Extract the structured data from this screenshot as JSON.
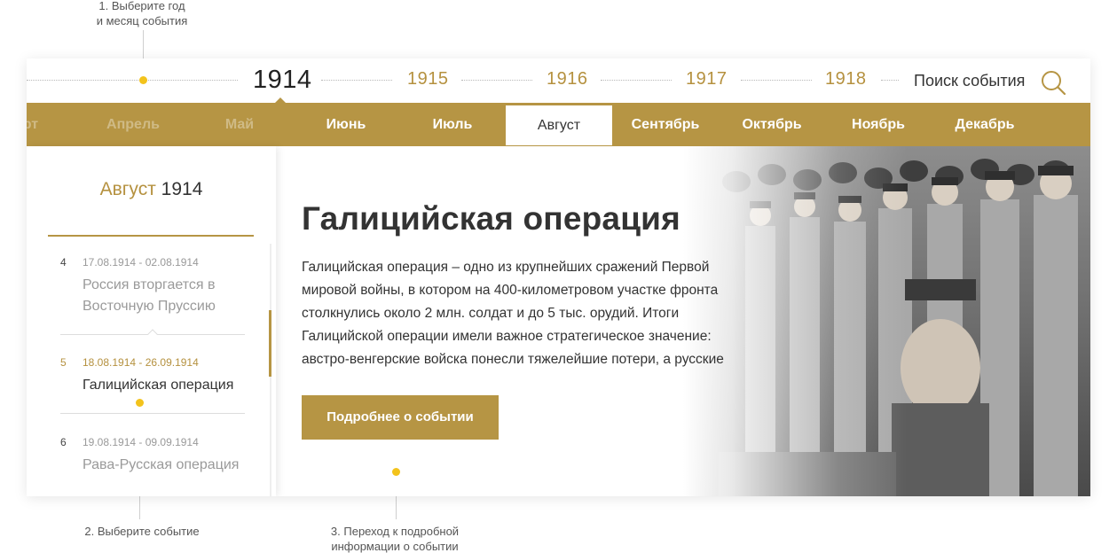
{
  "hints": {
    "step1_line1": "1. Выберите год",
    "step1_line2": "и месяц события",
    "step2": "2. Выберите событие",
    "step3_line1": "3. Переход к подробной",
    "step3_line2": "информации о событии"
  },
  "years": {
    "items": [
      "1914",
      "1915",
      "1916",
      "1917",
      "1918"
    ],
    "active": "1914"
  },
  "search": {
    "label": "Поиск события",
    "icon": "search-icon"
  },
  "months": {
    "items": [
      "арт",
      "Апрель",
      "Май",
      "Июнь",
      "Июль",
      "Август",
      "Сентябрь",
      "Октябрь",
      "Ноябрь",
      "Декабрь"
    ],
    "active": "Август"
  },
  "sidebar": {
    "title_month": "Август",
    "title_year": "1914",
    "events": [
      {
        "num": "4",
        "date": "17.08.1914 - 02.08.1914",
        "title": "Россия вторгается в Восточную Пруссию"
      },
      {
        "num": "5",
        "date": "18.08.1914 - 26.09.1914",
        "title": "Галицийская операция",
        "active": true
      },
      {
        "num": "6",
        "date": "19.08.1914 - 09.09.1914",
        "title": "Рава-Русская операция"
      }
    ]
  },
  "event": {
    "title": "Галицийская операция",
    "description": "Галицийская операция – одно из крупнейших сражений Первой мировой войны, в котором на 400-километровом участке фронта столкнулись около 2 млн. солдат и до 5 тыс. орудий. Итоги Галицийской операции имели важное стратегическое значение: австро-венгерские войска понесли тяжелейшие потери, а русские",
    "more_button": "Подробнее о событии",
    "photo": "soldiers-photo"
  },
  "colors": {
    "accent": "#b69544",
    "accent_text": "#b5913f",
    "hint_dot": "#f3c31c",
    "text": "#333333"
  }
}
